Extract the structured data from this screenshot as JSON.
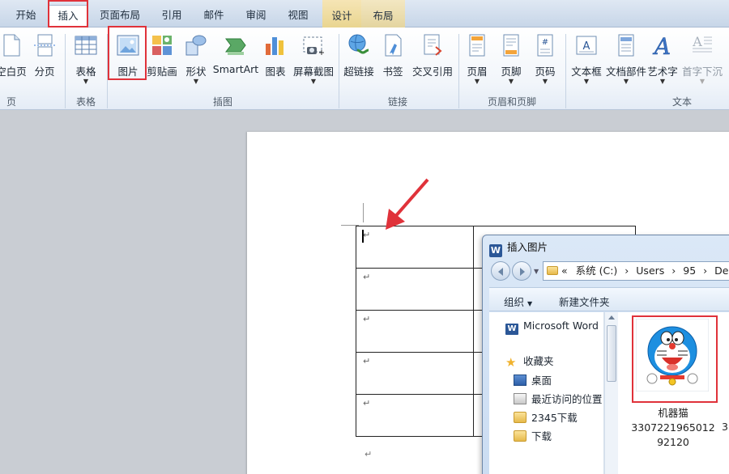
{
  "tabs": [
    "开始",
    "插入",
    "页面布局",
    "引用",
    "邮件",
    "审阅",
    "视图",
    "设计",
    "布局"
  ],
  "ribbon": {
    "buttons": [
      {
        "label": "空白页",
        "icon": "blank-page-icon"
      },
      {
        "label": "分页",
        "icon": "page-break-icon"
      },
      {
        "label": "表格",
        "icon": "table-icon"
      },
      {
        "label": "图片",
        "icon": "picture-icon"
      },
      {
        "label": "剪贴画",
        "icon": "clip-art-icon"
      },
      {
        "label": "形状",
        "icon": "shapes-icon"
      },
      {
        "label": "SmartArt",
        "icon": "smartart-icon"
      },
      {
        "label": "图表",
        "icon": "chart-icon"
      },
      {
        "label": "屏幕截图",
        "icon": "screenshot-icon"
      },
      {
        "label": "超链接",
        "icon": "hyperlink-icon"
      },
      {
        "label": "书签",
        "icon": "bookmark-icon"
      },
      {
        "label": "交叉引用",
        "icon": "cross-reference-icon"
      },
      {
        "label": "页眉",
        "icon": "header-icon"
      },
      {
        "label": "页脚",
        "icon": "footer-icon"
      },
      {
        "label": "页码",
        "icon": "page-number-icon"
      },
      {
        "label": "文本框",
        "icon": "text-box-icon"
      },
      {
        "label": "文档部件",
        "icon": "quick-parts-icon"
      },
      {
        "label": "艺术字",
        "icon": "wordart-icon"
      },
      {
        "label": "首字下沉",
        "icon": "drop-cap-icon"
      }
    ],
    "groups": [
      "页",
      "表格",
      "插图",
      "链接",
      "页眉和页脚",
      "文本"
    ]
  },
  "document": {
    "para_mark": "↵"
  },
  "dialog": {
    "title": "插入图片",
    "title_icon": "W",
    "address": {
      "prefix": "«",
      "segments": [
        "系统 (C:)",
        "Users",
        "95",
        "De"
      ],
      "separator": "›"
    },
    "toolbar": {
      "organize": "组织",
      "new_folder": "新建文件夹"
    },
    "nav": [
      {
        "label": "Microsoft Word",
        "icon": "word-icon"
      },
      {
        "label": "收藏夹",
        "icon": "favorites-star-icon"
      },
      {
        "label": "桌面",
        "icon": "desktop-icon"
      },
      {
        "label": "最近访问的位置",
        "icon": "recent-places-icon"
      },
      {
        "label": "2345下载",
        "icon": "folder-icon"
      },
      {
        "label": "下载",
        "icon": "downloads-icon"
      }
    ],
    "file": {
      "name_line1": "机器猫",
      "name_line2": "3307221965012",
      "name_line3": "92120",
      "next_partial": "3"
    }
  },
  "colors": {
    "highlight": "#e0323a",
    "annotation_arrow": "#e0323a",
    "ribbon_accent": "#2b5797"
  }
}
